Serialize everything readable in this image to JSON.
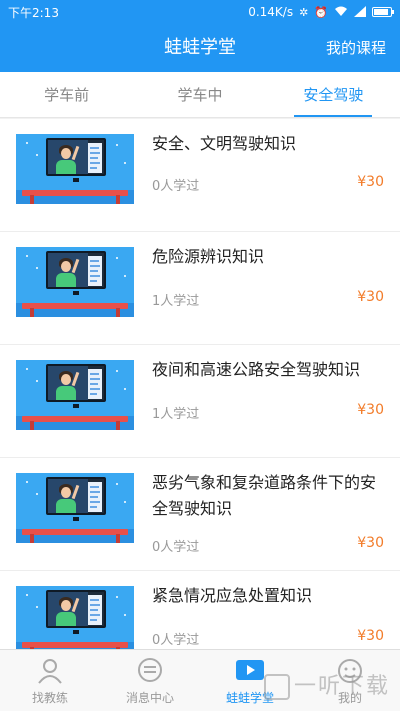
{
  "status_bar": {
    "time": "下午2:13",
    "speed": "0.14K/s"
  },
  "header": {
    "title": "蛙蛙学堂",
    "right_link": "我的课程"
  },
  "tabs": [
    {
      "label": "学车前",
      "active": false
    },
    {
      "label": "学车中",
      "active": false
    },
    {
      "label": "安全驾驶",
      "active": true
    }
  ],
  "courses": [
    {
      "name": "安全、文明驾驶知识",
      "learners": "0人学过",
      "price": "¥30"
    },
    {
      "name": "危险源辨识知识",
      "learners": "1人学过",
      "price": "¥30"
    },
    {
      "name": "夜间和高速公路安全驾驶知识",
      "learners": "1人学过",
      "price": "¥30"
    },
    {
      "name": "恶劣气象和复杂道路条件下的安全驾驶知识",
      "learners": "0人学过",
      "price": "¥30"
    },
    {
      "name": "紧急情况应急处置知识",
      "learners": "0人学过",
      "price": "¥30"
    }
  ],
  "bottom_nav": [
    {
      "label": "找教练",
      "icon": "coach-icon",
      "active": false
    },
    {
      "label": "消息中心",
      "icon": "message-icon",
      "active": false
    },
    {
      "label": "蛙蛙学堂",
      "icon": "video-play-icon",
      "active": true
    },
    {
      "label": "我的",
      "icon": "profile-icon",
      "active": false
    }
  ],
  "watermark": "一听下载",
  "colors": {
    "primary": "#2196f3",
    "price": "#f27c2a"
  }
}
